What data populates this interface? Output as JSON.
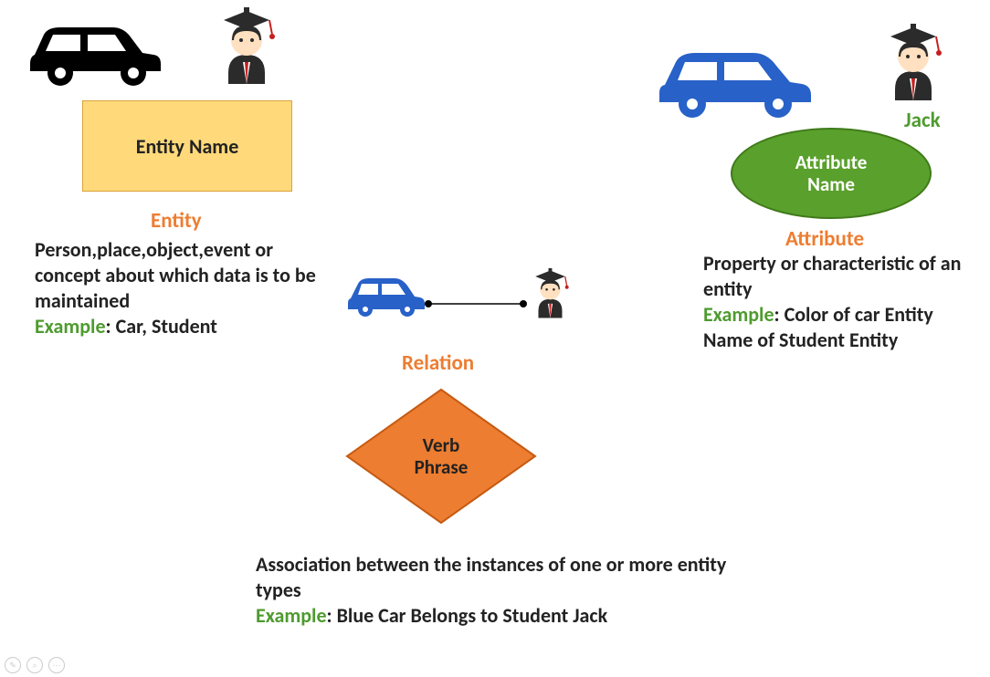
{
  "entity": {
    "box_label": "Entity Name",
    "section": "Entity",
    "desc": "Person,place,object,event or concept about which data is to be maintained",
    "example_kw": "Example",
    "example_text": ": Car, Student"
  },
  "attribute": {
    "ellipse_label": "Attribute Name",
    "section": "Attribute",
    "jack": "Jack",
    "desc": "Property or characteristic of an entity",
    "example_kw": "Example",
    "example_text": ": Color of car Entity Name of Student Entity"
  },
  "relation": {
    "diamond_label": "Verb Phrase",
    "section": "Relation",
    "desc": "Association between the instances of one or more entity types",
    "example_kw": "Example",
    "example_text": ": Blue Car Belongs to Student Jack"
  },
  "icons": {
    "car_black": "car-black-icon",
    "car_blue": "car-blue-icon",
    "student": "student-icon"
  }
}
